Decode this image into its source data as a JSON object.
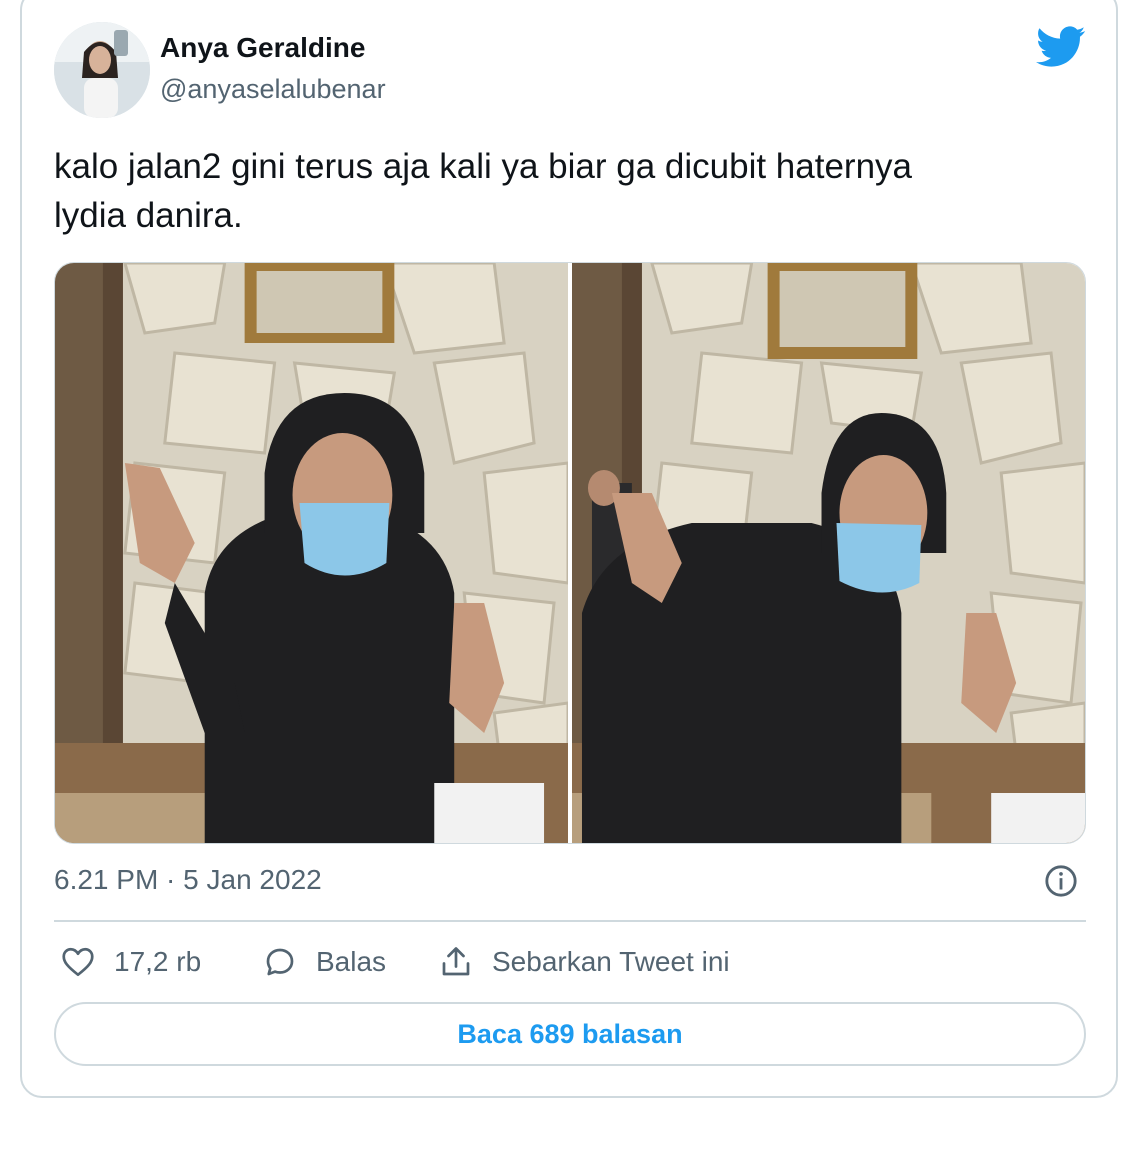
{
  "tweet": {
    "author_name": "Anya Geraldine",
    "author_handle": "@anyaselalubenar",
    "text_line1": "kalo jalan2 gini terus aja kali ya biar ga dicubit haternya",
    "text_line2": "lydia danira.",
    "timestamp": "6.21 PM · 5 Jan 2022",
    "photos": [
      {
        "alt": "photo-1"
      },
      {
        "alt": "photo-2"
      }
    ]
  },
  "actions": {
    "like_count": "17,2 rb",
    "reply_label": "Balas",
    "share_label": "Sebarkan Tweet ini"
  },
  "read_replies_label": "Baca 689 balasan",
  "icons": {
    "brand": "twitter-bird-icon",
    "like": "heart-icon",
    "reply": "speech-bubble-icon",
    "share": "share-upload-icon",
    "info": "info-icon"
  },
  "colors": {
    "accent": "#1d9bf0",
    "text": "#0f1419",
    "secondary": "#536471",
    "border": "#cfd9de"
  }
}
